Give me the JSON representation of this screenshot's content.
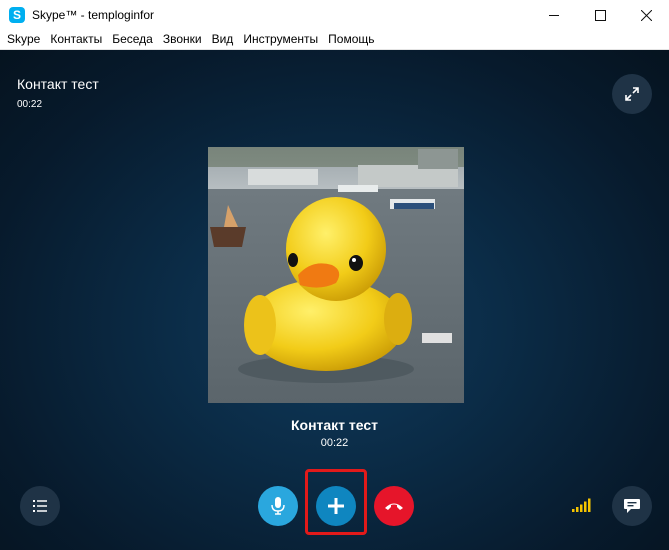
{
  "window": {
    "title": "Skype™ - temploginfor",
    "app_icon": "S",
    "controls": [
      "minimize-icon",
      "maximize-icon",
      "close-icon"
    ]
  },
  "menu": {
    "items": [
      {
        "label": "Skype"
      },
      {
        "label": "Контакты"
      },
      {
        "label": "Беседа"
      },
      {
        "label": "Звонки"
      },
      {
        "label": "Вид"
      },
      {
        "label": "Инструменты"
      },
      {
        "label": "Помощь"
      }
    ]
  },
  "call": {
    "contact_name": "Контакт тест",
    "duration": "00:22",
    "colors": {
      "background": "#0b2c47",
      "mic": "#2aa7de",
      "add": "#0f86c0",
      "hangup": "#e6152a",
      "signal": "#f5c400",
      "highlight": "#e21a1a"
    },
    "controls": {
      "fullscreen": "expand-icon",
      "dialpad": "list-icon",
      "mic": "microphone-icon",
      "add": "plus-icon",
      "hangup": "hangup-icon",
      "signal": "signal-bars-icon",
      "chat": "chat-icon"
    }
  }
}
